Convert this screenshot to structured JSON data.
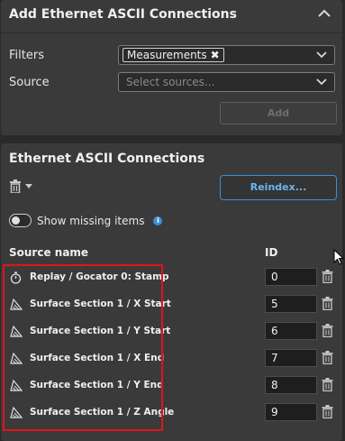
{
  "add_panel": {
    "title": "Add Ethernet ASCII Connections",
    "filters_label": "Filters",
    "filter_chip": "Measurements",
    "source_label": "Source",
    "source_placeholder": "Select sources...",
    "add_button": "Add"
  },
  "conn_panel": {
    "title": "Ethernet ASCII Connections",
    "reindex_button": "Reindex...",
    "show_missing_label": "Show missing items",
    "col_source": "Source name",
    "col_id": "ID",
    "rows": [
      {
        "name": "Replay / Gocator 0: Stamp",
        "id": "0",
        "icon": "stopwatch-icon"
      },
      {
        "name": "Surface Section 1 / X Start",
        "id": "5",
        "icon": "section-measure-icon"
      },
      {
        "name": "Surface Section 1 / Y Start",
        "id": "6",
        "icon": "section-measure-icon"
      },
      {
        "name": "Surface Section 1 / X End",
        "id": "7",
        "icon": "section-measure-icon"
      },
      {
        "name": "Surface Section 1 / Y End",
        "id": "8",
        "icon": "section-measure-icon"
      },
      {
        "name": "Surface Section 1 / Z Angle",
        "id": "9",
        "icon": "section-measure-icon"
      }
    ]
  },
  "colors": {
    "accent": "#3b8fd6",
    "highlight": "#e0141c",
    "panel": "#3a3a3a"
  }
}
